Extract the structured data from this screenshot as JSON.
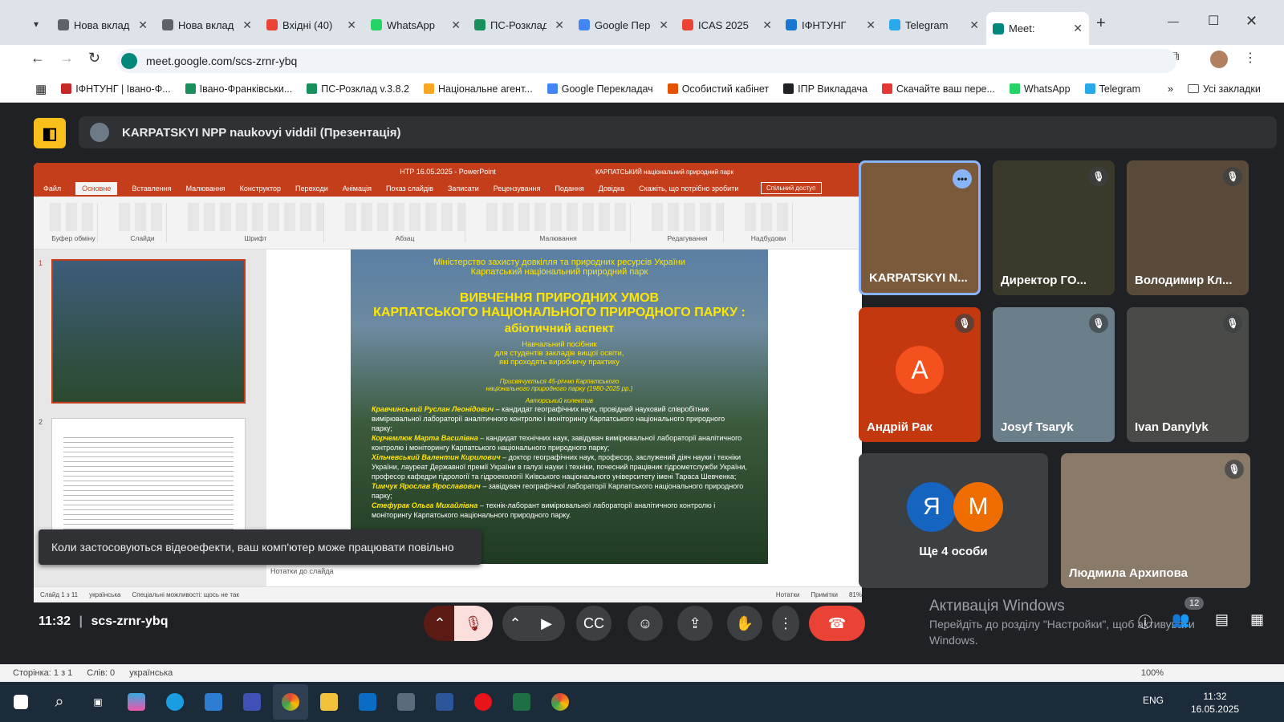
{
  "browser": {
    "tabs": [
      {
        "label": "Нова вкладка",
        "color": "#5f6368"
      },
      {
        "label": "Нова вкладка",
        "color": "#5f6368"
      },
      {
        "label": "Вхідні (40)",
        "color": "#ea4335"
      },
      {
        "label": "WhatsApp",
        "color": "#25d366"
      },
      {
        "label": "ПС-Розклад",
        "color": "#1a8f5e"
      },
      {
        "label": "Google Переклад",
        "color": "#4285f4"
      },
      {
        "label": "ICAS 2025",
        "color": "#ea4335"
      },
      {
        "label": "ІФНТУНГ",
        "color": "#1976d2"
      },
      {
        "label": "Telegram",
        "color": "#29a9eb"
      },
      {
        "label": "Meet: ",
        "color": "#00897b"
      }
    ],
    "url": "meet.google.com/scs-zrnr-ybq",
    "bookmarks": [
      "ІФНТУНГ | Івано-Ф...",
      "Івано-Франківськи...",
      "ПС-Розклад v.3.8.2",
      "Національне агент...",
      "Google Перекладач",
      "Особистий кабінет",
      "ІПР Викладача",
      "Скачайте ваш пере...",
      "WhatsApp",
      "Telegram"
    ],
    "all_bookmarks": "Усі закладки"
  },
  "meet": {
    "presenter_title": "KARPATSKYI NPP naukovyi viddil (Презентація)",
    "meeting_code": "scs-zrnr-ybq",
    "time": "11:32",
    "toast": "Коли застосовуються відеоефекти, ваш комп'ютер може працювати повільно",
    "participants": [
      {
        "name": "KARPATSKYI N...",
        "initial": "",
        "bg": "#7a5a3a"
      },
      {
        "name": "Директор ГО...",
        "initial": "",
        "bg": "#3b3a2a"
      },
      {
        "name": "Володимир Кл...",
        "initial": "",
        "bg": "#5a4a3a"
      },
      {
        "name": "Андрій Рак",
        "initial": "А",
        "bg": "#c4380f"
      },
      {
        "name": "Josyf Tsaryk",
        "initial": "",
        "bg": "#6b7f8a"
      },
      {
        "name": "Ivan Danylyk",
        "initial": "",
        "bg": "#4a4a48"
      },
      {
        "name": "Ще 4 особи",
        "initial": "",
        "bg": "#3c4043"
      },
      {
        "name": "Людмила Архипова",
        "initial": "",
        "bg": "#8a7a6a"
      }
    ],
    "more_avatars": [
      "Я",
      "М"
    ],
    "people_count": "12",
    "activate_windows": [
      "Активація Windows",
      "Перейдіть до розділу \"Настройки\", щоб активувати",
      "Windows."
    ]
  },
  "ppt": {
    "title": "НТР 16.05.2025 - PowerPoint",
    "warning": "КАРПАТСЬКИЙ національний природний парк",
    "share": "Спільний доступ",
    "tabs": [
      "Файл",
      "Основне",
      "Вставлення",
      "Малювання",
      "Конструктор",
      "Переходи",
      "Анімація",
      "Показ слайдів",
      "Записати",
      "Рецензування",
      "Подання",
      "Довідка",
      "Скажіть, що потрібно зробити"
    ],
    "ribbon_groups": [
      "Буфер обміну",
      "Слайди",
      "Шрифт",
      "Абзац",
      "Малювання",
      "Редагування",
      "Надбудови"
    ],
    "slide": {
      "ministry": "Міністерство захисту довкілля та природних ресурсів України",
      "park": "Карпатський національний природний парк",
      "title1": "ВИВЧЕННЯ ПРИРОДНИХ УМОВ",
      "title2": "КАРПАТСЬКОГО НАЦІОНАЛЬНОГО ПРИРОДНОГО ПАРКУ :",
      "title3": "абіотичний аспект",
      "sub1": "Навчальний посібник",
      "sub2": "для студентів закладів вищої освіти,",
      "sub3": "які проходять виробничу практику",
      "dedic1": "Присвячується 45-річчю Карпатського",
      "dedic2": "національного природного парку (1980-2025 рр.)",
      "authors_label": "Авторський колектив",
      "authors": [
        {
          "n": "Кравчинський Руслан Леонідович",
          "t": " – кандидат географічних наук, провідний науковий співробітник вимірювальної лабораторії аналітичного контролю і моніторингу Карпатського національного природного парку;"
        },
        {
          "n": "Корчемлюк Марта Василівна",
          "t": " – кандидат технічних наук, завідувач вимірювальної лабораторії аналітичного контролю і моніторингу Карпатського національного природного парку;"
        },
        {
          "n": "Хільчевський Валентин Кирилович",
          "t": " – доктор географічних наук, професор, заслужений діяч науки і техніки України, лауреат Державної премії України в галузі науки і техніки, почесний працівник гідрометслужби України, професор кафедри гідрології та гідроекології Київського національного університету імені Тараса Шевченка;"
        },
        {
          "n": "Тимчук Ярослав Ярославович",
          "t": " – завідувач географічної лабораторії Карпатського національного природного парку;"
        },
        {
          "n": "Стефурак Ольга Михайлівна",
          "t": " – технік-лаборант вимірювальної лабораторії аналітичного контролю і моніторингу Карпатського національного природного парку."
        }
      ]
    },
    "notes": "Нотатки до слайда",
    "status": [
      "Слайд 1 з 11",
      "українська",
      "Спеціальні можливості: щось не так",
      "Нотатки",
      "Примітки",
      "81%"
    ]
  },
  "word_status": [
    "Сторінка: 1 з 1",
    "Слів: 0",
    "українська",
    "100%"
  ],
  "taskbar": {
    "lang": "ENG",
    "time": "11:32",
    "date": "16.05.2025"
  }
}
